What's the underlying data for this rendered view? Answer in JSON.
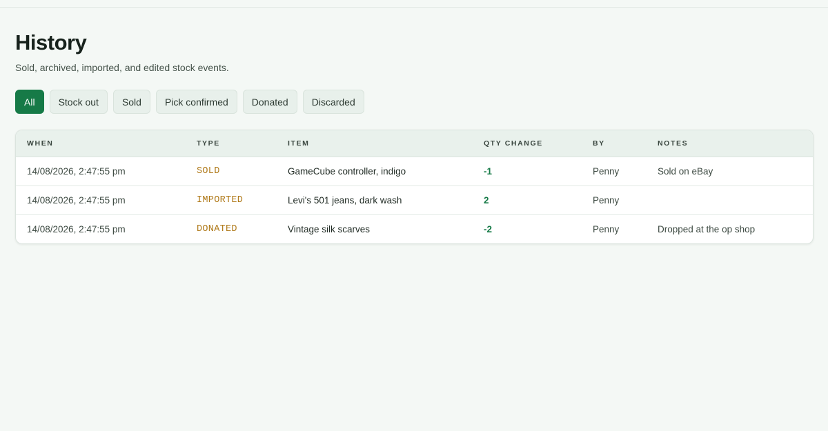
{
  "page": {
    "title": "History",
    "subtitle": "Sold, archived, imported, and edited stock events."
  },
  "filters": [
    {
      "label": "All",
      "active": true
    },
    {
      "label": "Stock out",
      "active": false
    },
    {
      "label": "Sold",
      "active": false
    },
    {
      "label": "Pick confirmed",
      "active": false
    },
    {
      "label": "Donated",
      "active": false
    },
    {
      "label": "Discarded",
      "active": false
    }
  ],
  "table": {
    "columns": [
      "WHEN",
      "TYPE",
      "ITEM",
      "QTY CHANGE",
      "BY",
      "NOTES"
    ],
    "rows": [
      {
        "when": "14/08/2026, 2:47:55 pm",
        "type": "SOLD",
        "item": "GameCube controller, indigo",
        "qty": "-1",
        "by": "Penny",
        "notes": "Sold on eBay"
      },
      {
        "when": "14/08/2026, 2:47:55 pm",
        "type": "IMPORTED",
        "item": "Levi's 501 jeans, dark wash",
        "qty": "2",
        "by": "Penny",
        "notes": ""
      },
      {
        "when": "14/08/2026, 2:47:55 pm",
        "type": "DONATED",
        "item": "Vintage silk scarves",
        "qty": "-2",
        "by": "Penny",
        "notes": "Dropped at the op shop"
      }
    ]
  },
  "colors": {
    "accent": "#167a47",
    "type_label": "#b07a1a",
    "background": "#f4f8f5"
  }
}
